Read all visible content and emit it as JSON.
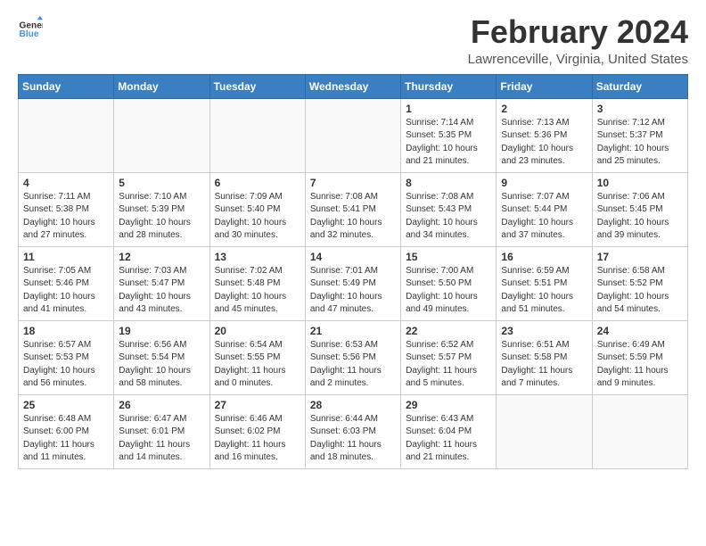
{
  "logo": {
    "text_general": "General",
    "text_blue": "Blue"
  },
  "header": {
    "title": "February 2024",
    "subtitle": "Lawrenceville, Virginia, United States"
  },
  "weekdays": [
    "Sunday",
    "Monday",
    "Tuesday",
    "Wednesday",
    "Thursday",
    "Friday",
    "Saturday"
  ],
  "weeks": [
    [
      {
        "day": "",
        "info": ""
      },
      {
        "day": "",
        "info": ""
      },
      {
        "day": "",
        "info": ""
      },
      {
        "day": "",
        "info": ""
      },
      {
        "day": "1",
        "info": "Sunrise: 7:14 AM\nSunset: 5:35 PM\nDaylight: 10 hours\nand 21 minutes."
      },
      {
        "day": "2",
        "info": "Sunrise: 7:13 AM\nSunset: 5:36 PM\nDaylight: 10 hours\nand 23 minutes."
      },
      {
        "day": "3",
        "info": "Sunrise: 7:12 AM\nSunset: 5:37 PM\nDaylight: 10 hours\nand 25 minutes."
      }
    ],
    [
      {
        "day": "4",
        "info": "Sunrise: 7:11 AM\nSunset: 5:38 PM\nDaylight: 10 hours\nand 27 minutes."
      },
      {
        "day": "5",
        "info": "Sunrise: 7:10 AM\nSunset: 5:39 PM\nDaylight: 10 hours\nand 28 minutes."
      },
      {
        "day": "6",
        "info": "Sunrise: 7:09 AM\nSunset: 5:40 PM\nDaylight: 10 hours\nand 30 minutes."
      },
      {
        "day": "7",
        "info": "Sunrise: 7:08 AM\nSunset: 5:41 PM\nDaylight: 10 hours\nand 32 minutes."
      },
      {
        "day": "8",
        "info": "Sunrise: 7:08 AM\nSunset: 5:43 PM\nDaylight: 10 hours\nand 34 minutes."
      },
      {
        "day": "9",
        "info": "Sunrise: 7:07 AM\nSunset: 5:44 PM\nDaylight: 10 hours\nand 37 minutes."
      },
      {
        "day": "10",
        "info": "Sunrise: 7:06 AM\nSunset: 5:45 PM\nDaylight: 10 hours\nand 39 minutes."
      }
    ],
    [
      {
        "day": "11",
        "info": "Sunrise: 7:05 AM\nSunset: 5:46 PM\nDaylight: 10 hours\nand 41 minutes."
      },
      {
        "day": "12",
        "info": "Sunrise: 7:03 AM\nSunset: 5:47 PM\nDaylight: 10 hours\nand 43 minutes."
      },
      {
        "day": "13",
        "info": "Sunrise: 7:02 AM\nSunset: 5:48 PM\nDaylight: 10 hours\nand 45 minutes."
      },
      {
        "day": "14",
        "info": "Sunrise: 7:01 AM\nSunset: 5:49 PM\nDaylight: 10 hours\nand 47 minutes."
      },
      {
        "day": "15",
        "info": "Sunrise: 7:00 AM\nSunset: 5:50 PM\nDaylight: 10 hours\nand 49 minutes."
      },
      {
        "day": "16",
        "info": "Sunrise: 6:59 AM\nSunset: 5:51 PM\nDaylight: 10 hours\nand 51 minutes."
      },
      {
        "day": "17",
        "info": "Sunrise: 6:58 AM\nSunset: 5:52 PM\nDaylight: 10 hours\nand 54 minutes."
      }
    ],
    [
      {
        "day": "18",
        "info": "Sunrise: 6:57 AM\nSunset: 5:53 PM\nDaylight: 10 hours\nand 56 minutes."
      },
      {
        "day": "19",
        "info": "Sunrise: 6:56 AM\nSunset: 5:54 PM\nDaylight: 10 hours\nand 58 minutes."
      },
      {
        "day": "20",
        "info": "Sunrise: 6:54 AM\nSunset: 5:55 PM\nDaylight: 11 hours\nand 0 minutes."
      },
      {
        "day": "21",
        "info": "Sunrise: 6:53 AM\nSunset: 5:56 PM\nDaylight: 11 hours\nand 2 minutes."
      },
      {
        "day": "22",
        "info": "Sunrise: 6:52 AM\nSunset: 5:57 PM\nDaylight: 11 hours\nand 5 minutes."
      },
      {
        "day": "23",
        "info": "Sunrise: 6:51 AM\nSunset: 5:58 PM\nDaylight: 11 hours\nand 7 minutes."
      },
      {
        "day": "24",
        "info": "Sunrise: 6:49 AM\nSunset: 5:59 PM\nDaylight: 11 hours\nand 9 minutes."
      }
    ],
    [
      {
        "day": "25",
        "info": "Sunrise: 6:48 AM\nSunset: 6:00 PM\nDaylight: 11 hours\nand 11 minutes."
      },
      {
        "day": "26",
        "info": "Sunrise: 6:47 AM\nSunset: 6:01 PM\nDaylight: 11 hours\nand 14 minutes."
      },
      {
        "day": "27",
        "info": "Sunrise: 6:46 AM\nSunset: 6:02 PM\nDaylight: 11 hours\nand 16 minutes."
      },
      {
        "day": "28",
        "info": "Sunrise: 6:44 AM\nSunset: 6:03 PM\nDaylight: 11 hours\nand 18 minutes."
      },
      {
        "day": "29",
        "info": "Sunrise: 6:43 AM\nSunset: 6:04 PM\nDaylight: 11 hours\nand 21 minutes."
      },
      {
        "day": "",
        "info": ""
      },
      {
        "day": "",
        "info": ""
      }
    ]
  ]
}
